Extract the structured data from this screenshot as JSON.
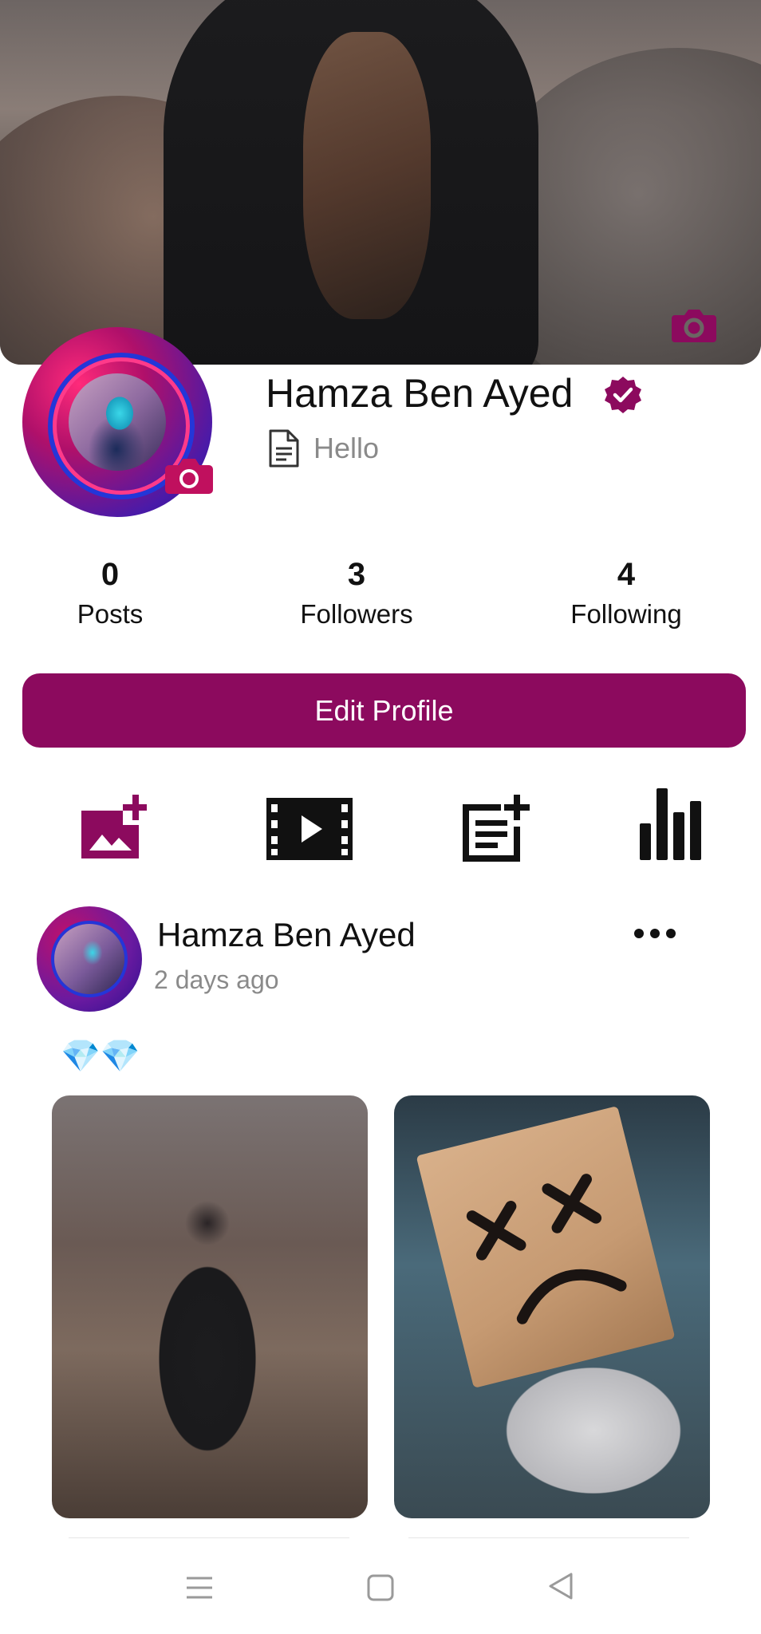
{
  "profile": {
    "name": "Hamza Ben Ayed",
    "bio": "Hello",
    "verified": true
  },
  "stats": {
    "posts": {
      "value": "0",
      "label": "Posts"
    },
    "followers": {
      "value": "3",
      "label": "Followers"
    },
    "following": {
      "value": "4",
      "label": "Following"
    }
  },
  "actions": {
    "edit_profile_label": "Edit Profile",
    "icons": [
      "add-photo-icon",
      "video-icon",
      "add-post-icon",
      "stats-icon"
    ]
  },
  "post": {
    "author": "Hamza Ben Ayed",
    "time": "2 days ago",
    "text": "💎💎"
  },
  "colors": {
    "accent": "#8c0a5e",
    "verified": "#8c0a5e",
    "text_muted": "#8a8a8a"
  },
  "nav": {
    "icons": [
      "menu-icon",
      "home-square-icon",
      "back-triangle-icon"
    ]
  }
}
